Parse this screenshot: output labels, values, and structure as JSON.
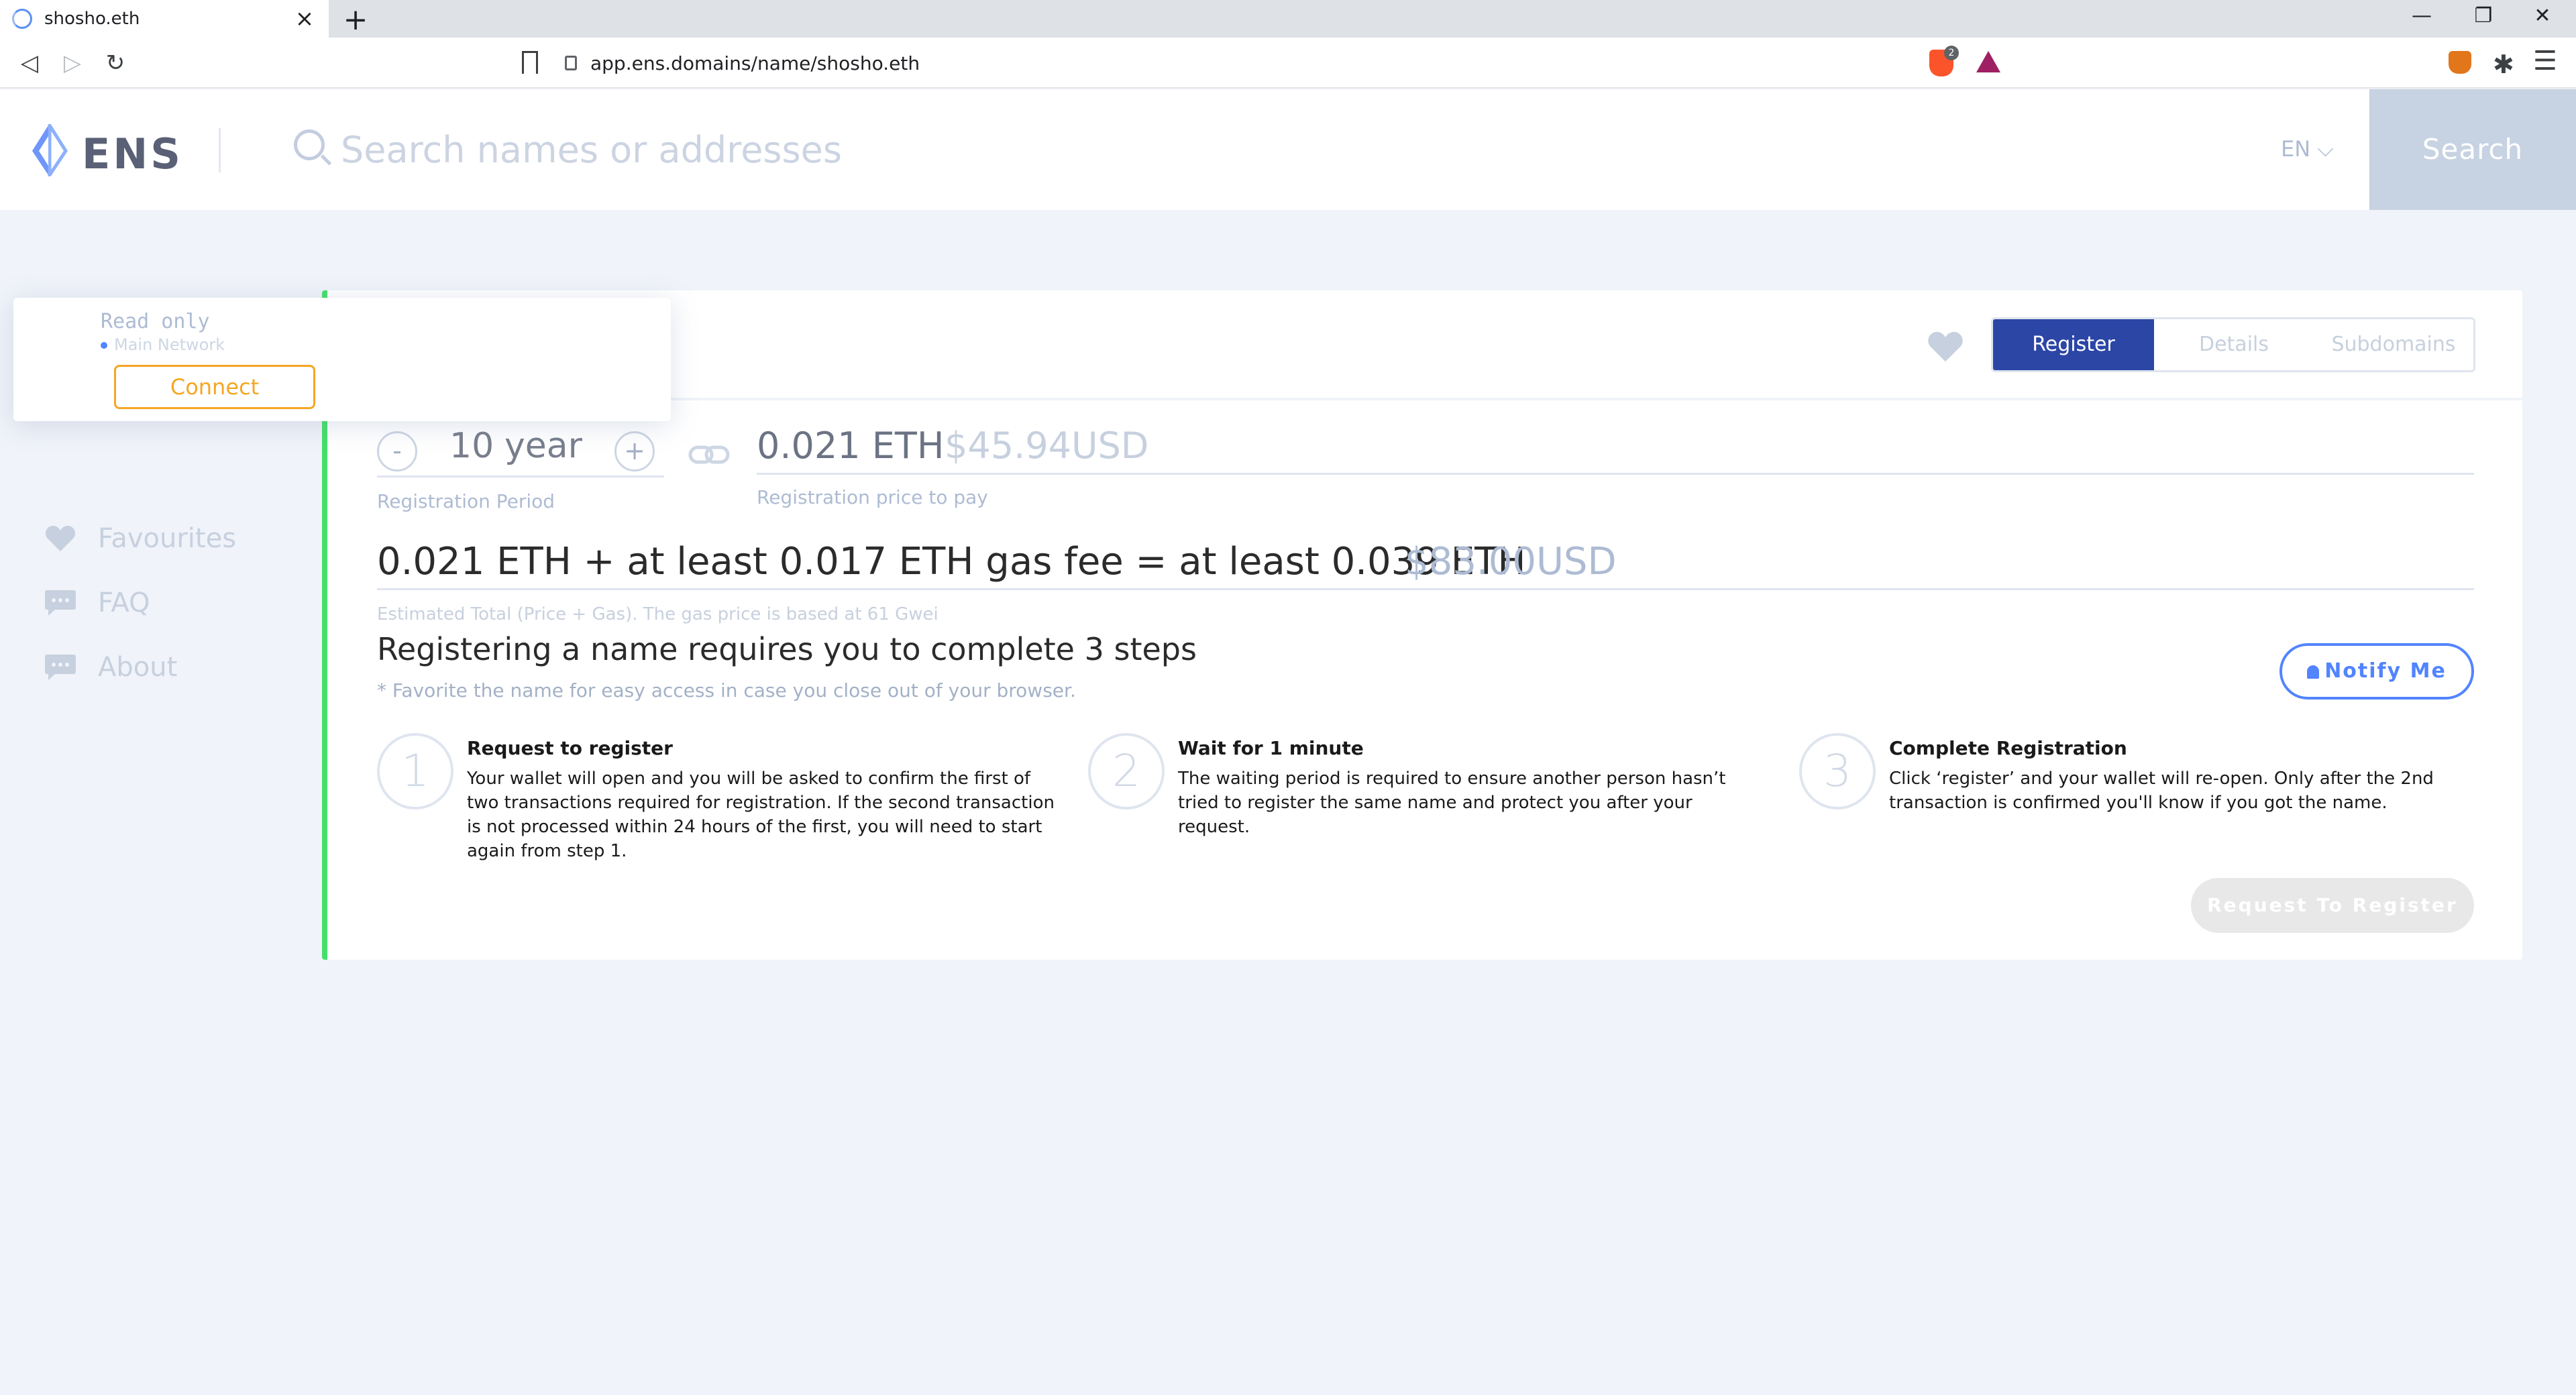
{
  "browser": {
    "tab_title": "shosho.eth",
    "tab_close": "×",
    "new_tab": "+",
    "back": "◁",
    "forward": "▷",
    "reload": "↻",
    "url": "app.ens.domains/name/shosho.eth",
    "brave_badge": "2",
    "window_minimize": "—",
    "window_restore": "❐",
    "window_close": "✕",
    "menu": "☰",
    "puzzle": "✱"
  },
  "header": {
    "brand": "ENS",
    "search_placeholder": "Search names or addresses",
    "language": "EN ⌵",
    "search_button": "Search"
  },
  "sidebar": {
    "items": [
      {
        "label": "Favourites",
        "icon": "heart-icon"
      },
      {
        "label": "FAQ",
        "icon": "chat-icon"
      },
      {
        "label": "About",
        "icon": "chat-icon"
      }
    ]
  },
  "wallet": {
    "status": "Read only",
    "network": "Main Network",
    "connect": "Connect"
  },
  "name_tabs": {
    "register": "Register",
    "details": "Details",
    "subdomains": "Subdomains",
    "active": "Register"
  },
  "registration": {
    "minus": "-",
    "plus": "+",
    "period_value": "10",
    "period_unit": "year",
    "period_label": "Registration Period",
    "price_eth": "0.021 ETH",
    "price_usd": "$45.94USD",
    "price_label": "Registration price to pay",
    "total_text": "0.021 ETH + at least 0.017 ETH gas fee = at least 0.039 ETH",
    "total_usd": "$83.00USD",
    "total_label": "Estimated Total (Price + Gas). The gas price is based at 61 Gwei"
  },
  "steps": {
    "title": "Registering a name requires you to complete 3 steps",
    "note": "* Favorite the name for easy access in case you close out of your browser.",
    "notify": "Notify Me",
    "items": [
      {
        "number": "1",
        "title": "Request to register",
        "body": "Your wallet will open and you will be asked to confirm the first of two transactions required for registration. If the second transaction is not processed within 24 hours of the first, you will need to start again from step 1."
      },
      {
        "number": "2",
        "title": "Wait for 1 minute",
        "body": "The waiting period is required to ensure another person hasn’t tried to register the same name and protect you after your request."
      },
      {
        "number": "3",
        "title": "Complete Registration",
        "body": "Click ‘register’ and your wallet will re-open. Only after the 2nd transaction is confirmed you'll know if you got the name."
      }
    ],
    "request_button": "Request To Register"
  },
  "colors": {
    "accent_blue": "#2c46a6",
    "link_blue": "#5284ff",
    "status_green": "#42e068",
    "connect_orange": "#f5a623"
  }
}
